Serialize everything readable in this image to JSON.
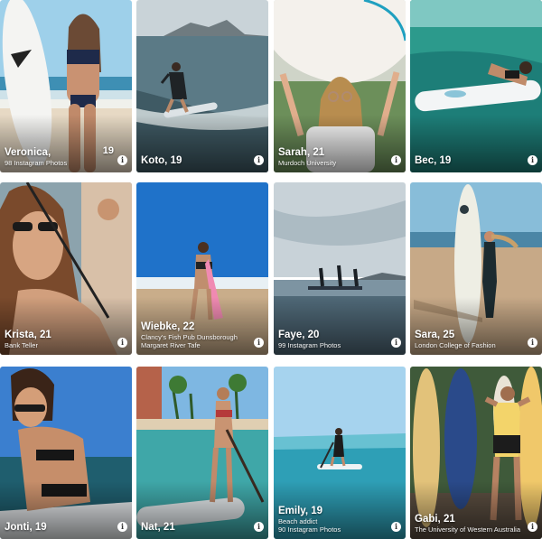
{
  "info_icon_glyph": "i",
  "cards": [
    {
      "name": "Veronica,",
      "badge": "19",
      "sub1": "98 Instagram Photos",
      "sub2": ""
    },
    {
      "name": "Koto, 19",
      "sub1": "",
      "sub2": ""
    },
    {
      "name": "Sarah, 21",
      "sub1": "Murdoch University",
      "sub2": ""
    },
    {
      "name": "Bec, 19",
      "sub1": "",
      "sub2": ""
    },
    {
      "name": "Krista, 21",
      "sub1": "Bank Teller",
      "sub2": ""
    },
    {
      "name": "Wiebke, 22",
      "sub1": "Clancy's Fish Pub Dunsborough",
      "sub2": "Margaret River Tafe"
    },
    {
      "name": "Faye, 20",
      "sub1": "99 Instagram Photos",
      "sub2": ""
    },
    {
      "name": "Sara, 25",
      "sub1": "London College of Fashion",
      "sub2": ""
    },
    {
      "name": "Jonti, 19",
      "sub1": "",
      "sub2": ""
    },
    {
      "name": "Nat, 21",
      "sub1": "",
      "sub2": ""
    },
    {
      "name": "Emily, 19",
      "sub1": "Beach addict",
      "sub2": "90 Instagram Photos"
    },
    {
      "name": "Gabi, 21",
      "sub1": "The University of Western Australia",
      "sub2": ""
    }
  ]
}
